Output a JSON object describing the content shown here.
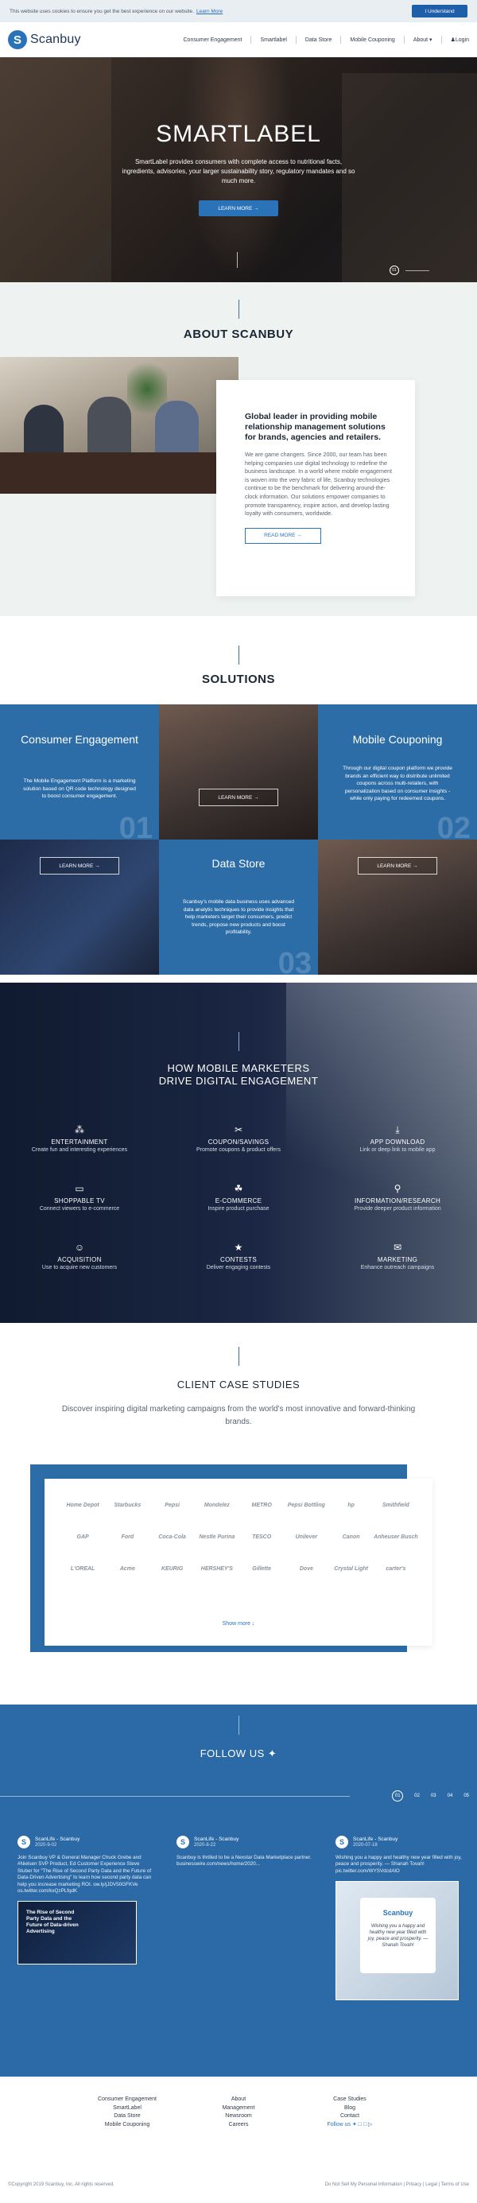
{
  "cookie": {
    "text": "This website uses cookies to ensure you get the best experience on our website.",
    "link": "Learn More",
    "accept": "I Understand"
  },
  "header": {
    "logo_text": "Scanbuy",
    "nav": [
      "Consumer Engagement",
      "Smartlabel",
      "Data Store",
      "Mobile Couponing",
      "About ▾",
      "Login"
    ]
  },
  "hero": {
    "title": "SMARTLABEL",
    "text": "SmartLabel provides consumers with complete access to nutritional facts, ingredients, advisories, your larger sustainability story, regulatory mandates and so much more.",
    "button": "LEARN MORE →",
    "pager_current": "01"
  },
  "about": {
    "title": "ABOUT SCANBUY",
    "heading": "Global leader in providing mobile relationship management solutions for brands, agencies and retailers.",
    "body": "We are game changers. Since 2000, our team has been helping companies use digital technology to redefine the business landscape. In a world where mobile engagement is woven into the very fabric of life, Scanbuy technologies continue to be the benchmark for delivering around-the-clock information. Our solutions empower companies to promote transparency, inspire action, and develop lasting loyalty with consumers, worldwide.",
    "button": "READ MORE →"
  },
  "solutions": {
    "title": "SOLUTIONS",
    "consumer": {
      "title": "Consumer Engagement",
      "text": "The Mobile Engagement Platform is a marketing solution based on QR code technology designed to boost consumer engagement.",
      "num": "01"
    },
    "coupon": {
      "title": "Mobile Couponing",
      "text": "Through our digital coupon platform we provide brands an efficient way to distribute unlimited coupons across multi-retailers, with personalization based on consumer insights - while only paying for redeemed coupons.",
      "num": "02"
    },
    "datastore": {
      "title": "Data Store",
      "text": "Scanbuy's mobile data business uses advanced data analytic techniques to provide insights that help marketers target their consumers, predict trends, propose new products and boost profitability.",
      "num": "03"
    },
    "learn_more": "LEARN MORE →"
  },
  "drive": {
    "title_line1": "HOW MOBILE MARKETERS",
    "title_line2": "DRIVE DIGITAL ENGAGEMENT",
    "features": [
      {
        "title": "ENTERTAINMENT",
        "desc": "Create fun and interesting experiences",
        "icon": "⁂"
      },
      {
        "title": "COUPON/SAVINGS",
        "desc": "Promote coupons & product offers",
        "icon": "✂"
      },
      {
        "title": "APP DOWNLOAD",
        "desc": "Link or deep link to mobile app",
        "icon": "⤓"
      },
      {
        "title": "SHOPPABLE TV",
        "desc": "Connect viewers to e-commerce",
        "icon": "▭"
      },
      {
        "title": "E-COMMERCE",
        "desc": "Inspire product purchase",
        "icon": "☘"
      },
      {
        "title": "INFORMATION/RESEARCH",
        "desc": "Provide deeper product information",
        "icon": "⚲"
      },
      {
        "title": "ACQUISITION",
        "desc": "Use to acquire new customers",
        "icon": "☺"
      },
      {
        "title": "CONTESTS",
        "desc": "Deliver engaging contests",
        "icon": "★"
      },
      {
        "title": "MARKETING",
        "desc": "Enhance outreach campaigns",
        "icon": "✉"
      }
    ]
  },
  "cases": {
    "title": "CLIENT CASE STUDIES",
    "subtitle": "Discover inspiring digital marketing campaigns from the world's most innovative and forward-thinking brands.",
    "brands": [
      "Home Depot",
      "Starbucks",
      "Pepsi",
      "Mondelez",
      "METRO",
      "Pepsi Bottling",
      "hp",
      "Smithfield",
      "GAP",
      "Ford",
      "Coca-Cola",
      "Nestle Purina",
      "TESCO",
      "Unilever",
      "Canon",
      "Anheuser Busch",
      "L'OREAL",
      "Acme",
      "KEURIG",
      "HERSHEY'S",
      "Gillette",
      "Dove",
      "Crystal Light",
      "carter's"
    ],
    "show_more": "Show more ↓"
  },
  "follow": {
    "title": "FOLLOW US",
    "pager": [
      "01",
      "02",
      "03",
      "04",
      "05"
    ],
    "tweets": [
      {
        "name": "ScanLife - Scanbuy",
        "date": "2020-9-02",
        "body": "Join Scanbuy VP & General Manager Chuck Grebe and #Nielsen SVP Product, Ed Customer Experience Steve Stuber for \"The Rise of Second Party Data and the Future of Data-Driven Advertising\" to learn how second party data can help you increase marketing ROI. ow.ly/jJDV50GFKVe os.twitter.com/kxQzPLfqdK",
        "image_text": "The Rise of Second Party Data and the Future of Data-driven Advertising"
      },
      {
        "name": "ScanLife - Scanbuy",
        "date": "2020-8-22",
        "body": "Scanbuy is thrilled to be a Nexstar Data Marketplace partner. businesswire.com/news/home/2020..."
      },
      {
        "name": "ScanLife - Scanbuy",
        "date": "2020-07-18",
        "body": "Wishing you a happy and healthy new year filled with joy, peace and prosperity. — Shanah Tovah! pic.twitter.com/WYSVdcdAlO",
        "card_brand": "Scanbuy",
        "card_text": "Wishing you a happy and healthy new year filled with joy, peace and prosperity. — Shanah Tovah!"
      }
    ]
  },
  "footer": {
    "col1": [
      "Consumer Engagement",
      "SmartLabel",
      "Data Store",
      "Mobile Couponing"
    ],
    "col2": [
      "About",
      "Management",
      "Newsroom",
      "Careers"
    ],
    "col3": [
      "Case Studies",
      "Blog",
      "Contact"
    ],
    "follow_us": "Follow us",
    "copyright": "©Copyright 2019 Scanbuy, Inc. All rights reserved.",
    "legal": "Do Not Sell My Personal Information | Privacy | Legal | Terms of Use"
  }
}
